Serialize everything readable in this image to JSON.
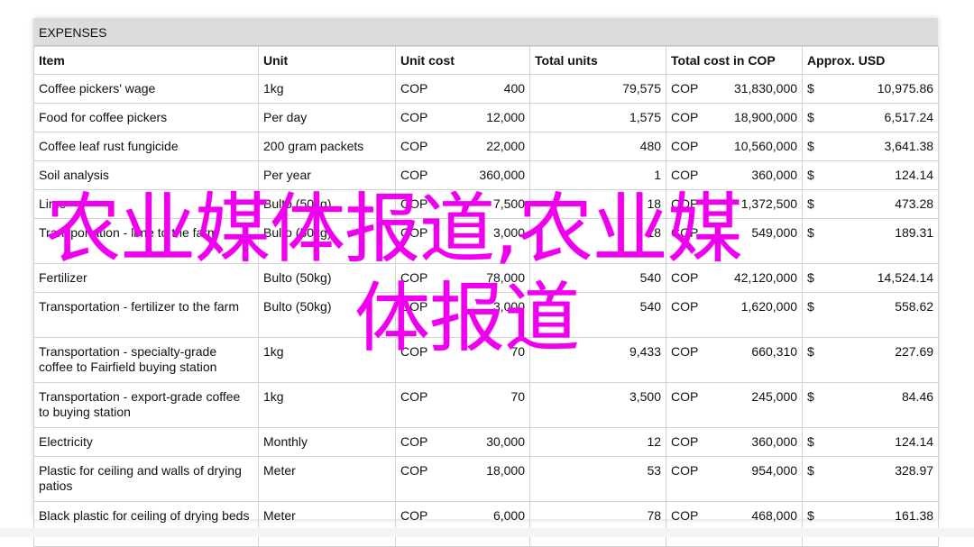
{
  "sheet": {
    "title": "EXPENSES",
    "headers": [
      "Item",
      "Unit",
      "Unit cost",
      "Total units",
      "Total cost in COP",
      "Approx. USD"
    ],
    "rows": [
      {
        "item": "Coffee pickers' wage",
        "unit": "1kg",
        "cost_cur": "COP",
        "cost": "400",
        "total_units": "79,575",
        "total_cur": "COP",
        "total": "31,830,000",
        "usd_cur": "$",
        "usd": "10,975.86"
      },
      {
        "item": "Food for coffee pickers",
        "unit": "Per day",
        "cost_cur": "COP",
        "cost": "12,000",
        "total_units": "1,575",
        "total_cur": "COP",
        "total": "18,900,000",
        "usd_cur": "$",
        "usd": "6,517.24"
      },
      {
        "item": "Coffee leaf rust fungicide",
        "unit": "200 gram packets",
        "cost_cur": "COP",
        "cost": "22,000",
        "total_units": "480",
        "total_cur": "COP",
        "total": "10,560,000",
        "usd_cur": "$",
        "usd": "3,641.38"
      },
      {
        "item": "Soil analysis",
        "unit": "Per year",
        "cost_cur": "COP",
        "cost": "360,000",
        "total_units": "1",
        "total_cur": "COP",
        "total": "360,000",
        "usd_cur": "$",
        "usd": "124.14"
      },
      {
        "item": "Lime",
        "unit": "Bulto (50kg)",
        "cost_cur": "COP",
        "cost": "7,500",
        "total_units": "18",
        "total_cur": "COP",
        "total": "1,372,500",
        "usd_cur": "$",
        "usd": "473.28"
      },
      {
        "item": "Transportation - lime to the farm",
        "unit": "Bulto (50kg)",
        "cost_cur": "COP",
        "cost": "3,000",
        "total_units": "18",
        "total_cur": "COP",
        "total": "549,000",
        "usd_cur": "$",
        "usd": "189.31"
      },
      {
        "item": "Fertilizer",
        "unit": "Bulto (50kg)",
        "cost_cur": "COP",
        "cost": "78,000",
        "total_units": "540",
        "total_cur": "COP",
        "total": "42,120,000",
        "usd_cur": "$",
        "usd": "14,524.14"
      },
      {
        "item": "Transportation - fertilizer to the farm",
        "unit": "Bulto (50kg)",
        "cost_cur": "COP",
        "cost": "3,000",
        "total_units": "540",
        "total_cur": "COP",
        "total": "1,620,000",
        "usd_cur": "$",
        "usd": "558.62"
      },
      {
        "item": "Transportation - specialty-grade coffee to Fairfield buying station",
        "unit": "1kg",
        "cost_cur": "COP",
        "cost": "70",
        "total_units": "9,433",
        "total_cur": "COP",
        "total": "660,310",
        "usd_cur": "$",
        "usd": "227.69"
      },
      {
        "item": "Transportation - export-grade coffee to buying station",
        "unit": "1kg",
        "cost_cur": "COP",
        "cost": "70",
        "total_units": "3,500",
        "total_cur": "COP",
        "total": "245,000",
        "usd_cur": "$",
        "usd": "84.46"
      },
      {
        "item": "Electricity",
        "unit": "Monthly",
        "cost_cur": "COP",
        "cost": "30,000",
        "total_units": "12",
        "total_cur": "COP",
        "total": "360,000",
        "usd_cur": "$",
        "usd": "124.14"
      },
      {
        "item": "Plastic for ceiling and walls of drying patios",
        "unit": "Meter",
        "cost_cur": "COP",
        "cost": "18,000",
        "total_units": "53",
        "total_cur": "COP",
        "total": "954,000",
        "usd_cur": "$",
        "usd": "328.97"
      },
      {
        "item": "Black plastic for ceiling of drying beds",
        "unit": "Meter",
        "cost_cur": "COP",
        "cost": "6,000",
        "total_units": "78",
        "total_cur": "COP",
        "total": "468,000",
        "usd_cur": "$",
        "usd": "161.38"
      }
    ]
  },
  "watermark": {
    "line1": "农业媒体报道,农业媒",
    "line2": "体报道",
    "color": "#ee00ee"
  }
}
